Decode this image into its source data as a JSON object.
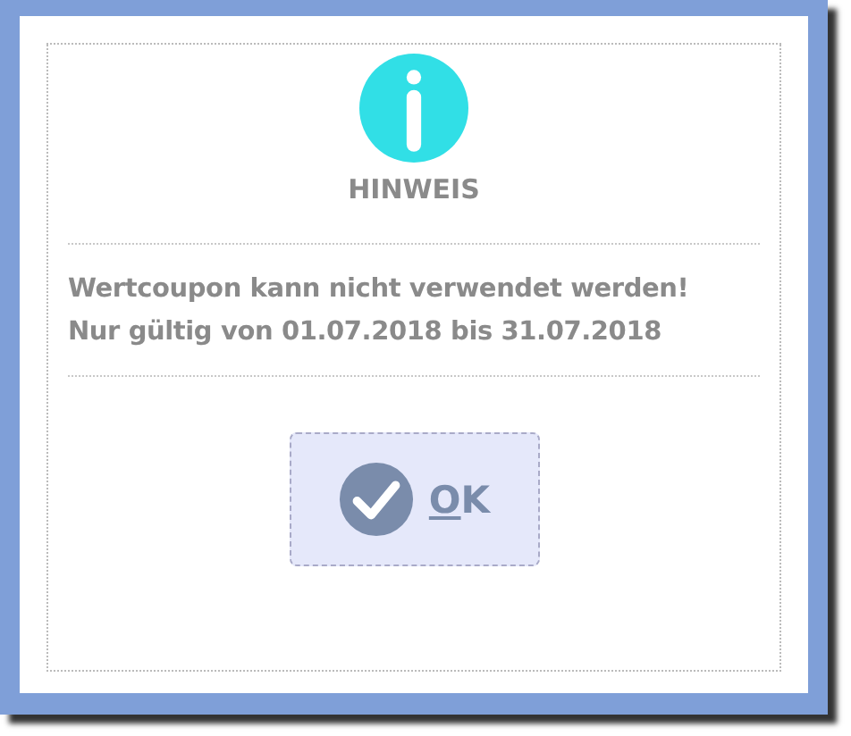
{
  "dialog": {
    "title": "HINWEIS",
    "message_lines": [
      "Wertcoupon kann nicht verwendet werden!",
      "Nur gültig von 01.07.2018 bis 31.07.2018"
    ],
    "buttons": [
      {
        "label": "OK",
        "kind": "confirm"
      }
    ]
  }
}
